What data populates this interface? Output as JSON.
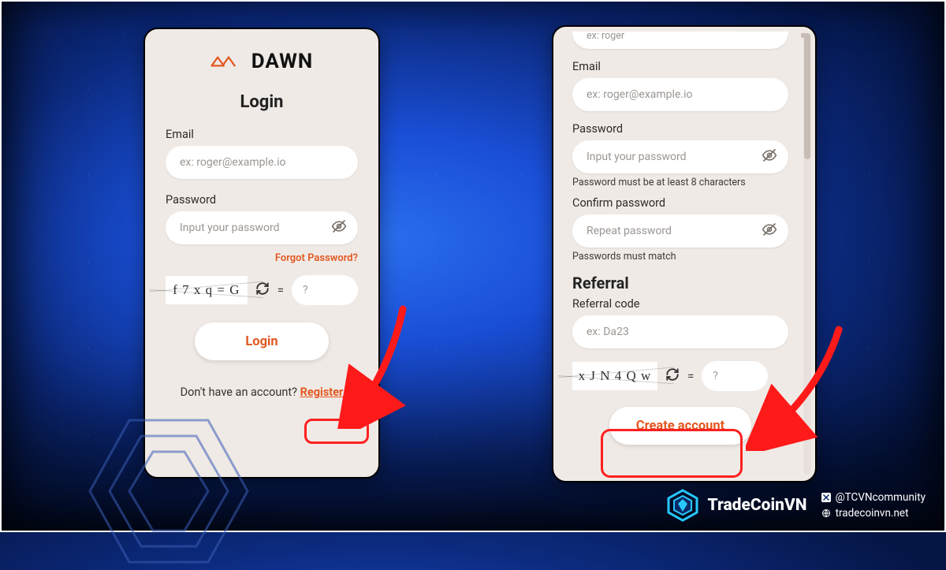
{
  "brand": {
    "name": "DAWN"
  },
  "login": {
    "title": "Login",
    "email_label": "Email",
    "email_placeholder": "ex: roger@example.io",
    "password_label": "Password",
    "password_placeholder": "Input your password",
    "forgot": "Forgot Password?",
    "captcha_text": "f 7 x q = G",
    "captcha_placeholder": "?",
    "login_btn": "Login",
    "no_account": "Don't have an account? ",
    "register": "Register"
  },
  "signup": {
    "name_peek": "ex: roger",
    "email_label": "Email",
    "email_placeholder": "ex: roger@example.io",
    "password_label": "Password",
    "password_placeholder": "Input your password",
    "password_hint": "Password must be at least 8 characters",
    "confirm_label": "Confirm password",
    "confirm_placeholder": "Repeat password",
    "confirm_hint": "Passwords must match",
    "referral_section": "Referral",
    "referral_label": "Referral code",
    "referral_placeholder": "ex: Da23",
    "captcha_text": "x J N 4 Q w",
    "captcha_placeholder": "?",
    "create_btn": "Create account"
  },
  "footer": {
    "brand": "TradeCoinVN",
    "twitter": "@TCVNcommunity",
    "site": "tradecoinvn.net"
  }
}
